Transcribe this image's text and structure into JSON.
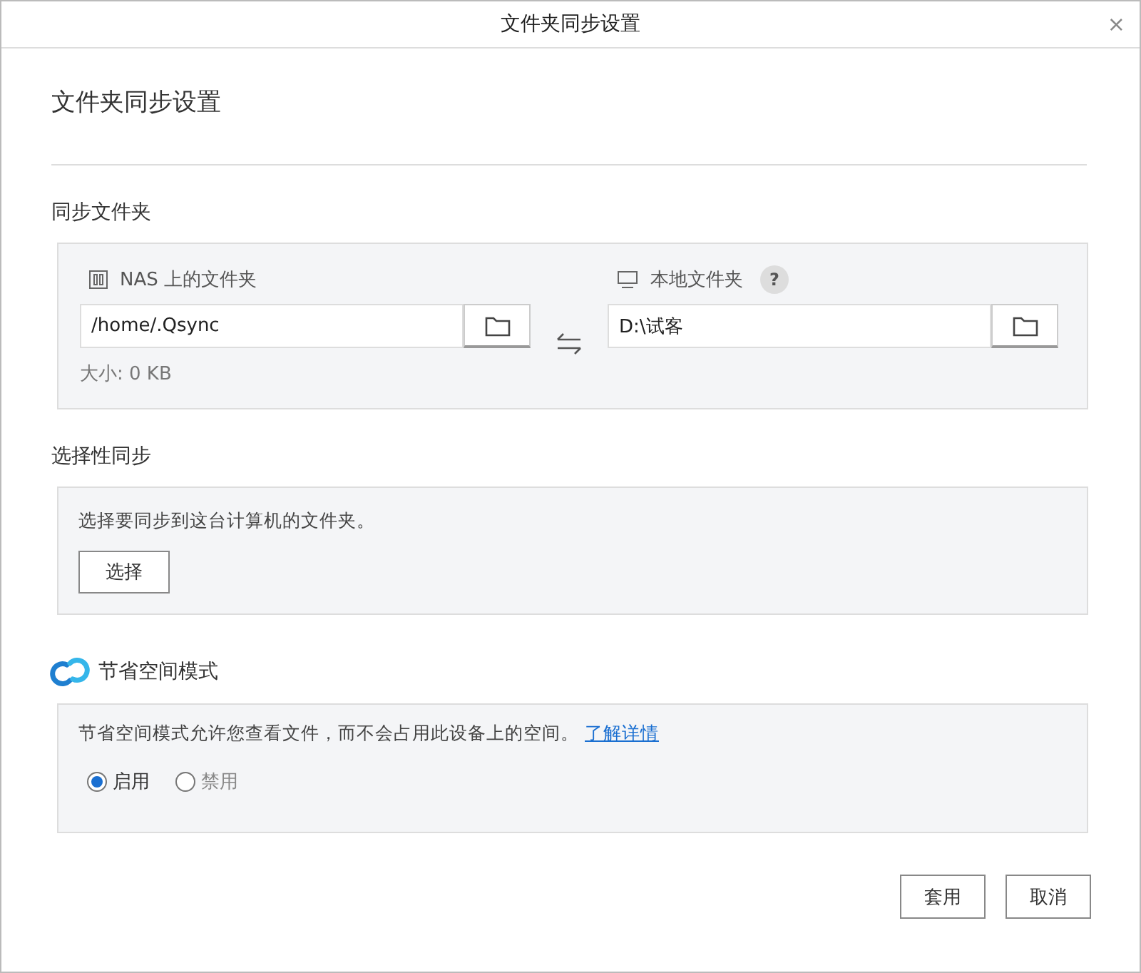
{
  "window": {
    "title": "文件夹同步设置",
    "close": "×"
  },
  "heading": "文件夹同步设置",
  "sync_folders": {
    "label": "同步文件夹",
    "nas": {
      "label": "NAS 上的文件夹",
      "value": "/home/.Qsync"
    },
    "local": {
      "label": "本地文件夹",
      "value": "D:\\试客",
      "help": "?"
    },
    "size": "大小: 0 KB"
  },
  "selective_sync": {
    "label": "选择性同步",
    "description": "选择要同步到这台计算机的文件夹。",
    "button": "选择"
  },
  "space_saving": {
    "label": "节省空间模式",
    "description": "节省空间模式允许您查看文件，而不会占用此设备上的空间。",
    "link": "了解详情",
    "options": [
      {
        "label": "启用",
        "selected": true
      },
      {
        "label": "禁用",
        "selected": false
      }
    ]
  },
  "buttons": [
    "套用",
    "取消"
  ]
}
